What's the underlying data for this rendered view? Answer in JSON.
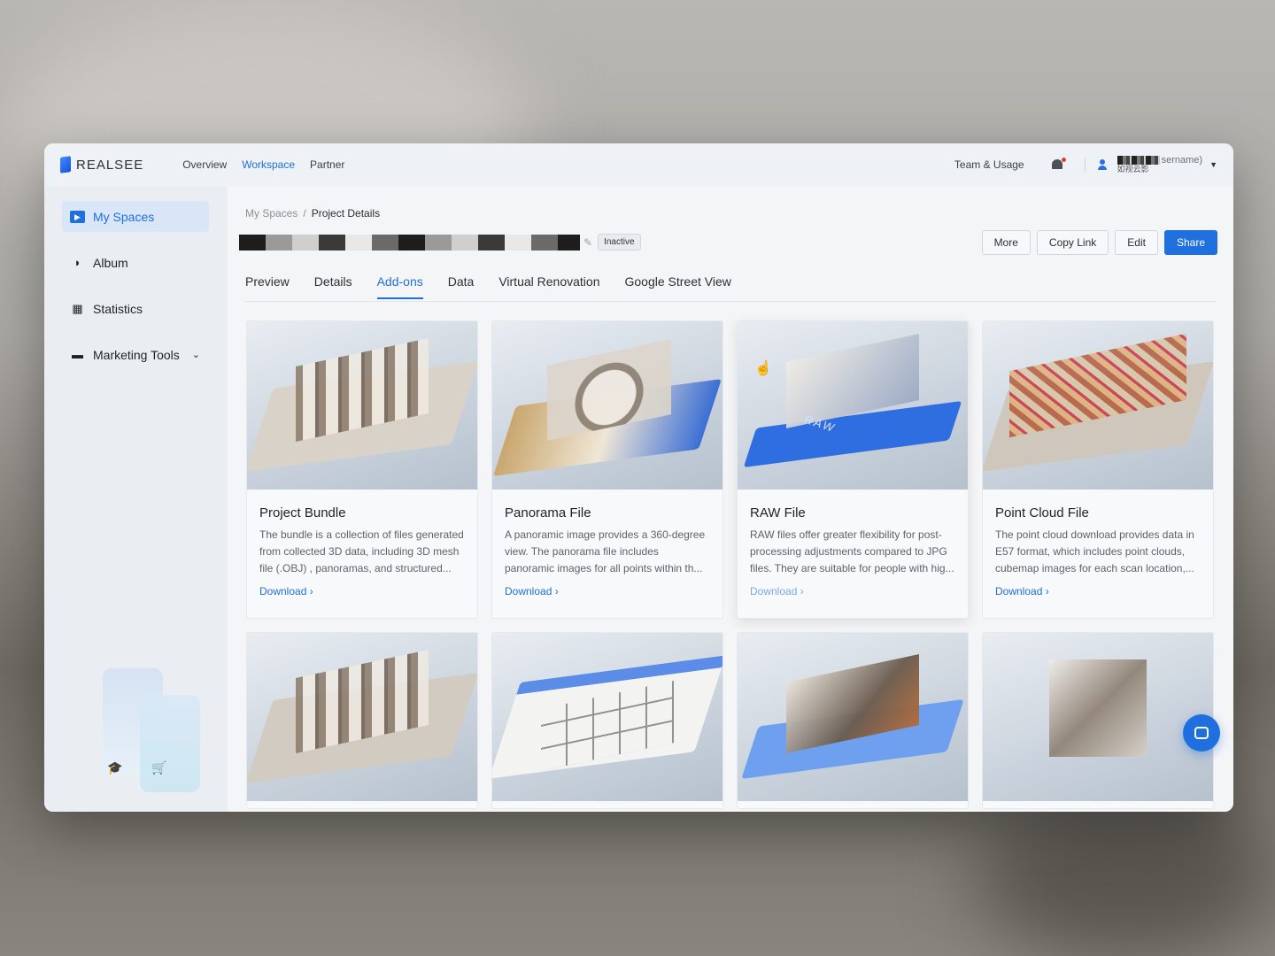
{
  "nav": {
    "logo": "REALSEE",
    "links": [
      "Overview",
      "Workspace",
      "Partner"
    ],
    "team_usage": "Team & Usage",
    "user_name_suffix": "sername)",
    "user_org": "如视云影"
  },
  "sidebar": {
    "items": [
      {
        "label": "My Spaces",
        "icon": "video-icon"
      },
      {
        "label": "Album",
        "icon": "flame-icon"
      },
      {
        "label": "Statistics",
        "icon": "calendar-icon"
      },
      {
        "label": "Marketing Tools",
        "icon": "briefcase-icon"
      }
    ]
  },
  "breadcrumb": {
    "root": "My Spaces",
    "separator": "/",
    "current": "Project Details"
  },
  "project": {
    "status": "Inactive"
  },
  "actions": {
    "more": "More",
    "copy_link": "Copy Link",
    "edit": "Edit",
    "share": "Share"
  },
  "tabs": [
    "Preview",
    "Details",
    "Add-ons",
    "Data",
    "Virtual Renovation",
    "Google Street View"
  ],
  "cards": [
    {
      "title": "Project Bundle",
      "desc": "The bundle is a collection of files generated from collected 3D data, including 3D mesh file (.OBJ) , panoramas, and structured...",
      "link": "Download"
    },
    {
      "title": "Panorama File",
      "desc": "A panoramic image provides a 360-degree view. The panorama file includes panoramic images for all points within th...",
      "link": "Download"
    },
    {
      "title": "RAW File",
      "desc": "RAW files offer greater flexibility for post-processing adjustments compared to JPG files. They are suitable for people with hig...",
      "link": "Download",
      "thumb_label": "RAW"
    },
    {
      "title": "Point Cloud File",
      "desc": "The point cloud download provides data in E57 format, which includes point clouds, cubemap images for each scan location,...",
      "link": "Download"
    }
  ],
  "colors": {
    "accent": "#1f6fde",
    "alert": "#e23b3b"
  }
}
